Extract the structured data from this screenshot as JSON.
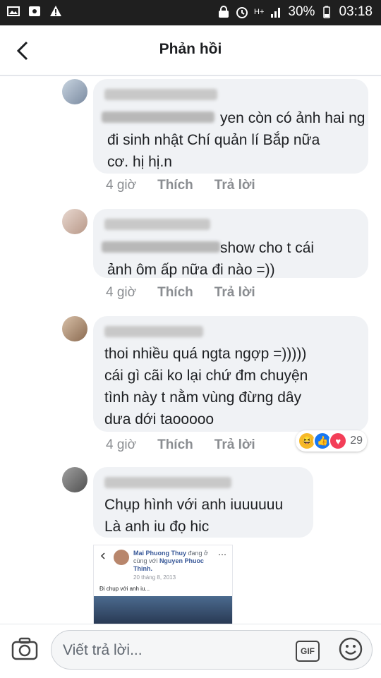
{
  "statusbar": {
    "battery": "30%",
    "time": "03:18",
    "network": "H+"
  },
  "header": {
    "title": "Phản hồi",
    "back_icon": "arrow-back-icon"
  },
  "comments": [
    {
      "text": "yen còn có ảnh hai ng\nđi sinh nhật Chí quản lí Bắp nữa\ncơ. hị hị.n",
      "time": "4 giờ",
      "like": "Thích",
      "reply": "Trả lời"
    },
    {
      "text": "show cho t cái\nảnh ôm ấp nữa đi nào =))",
      "time": "4 giờ",
      "like": "Thích",
      "reply": "Trả lời"
    },
    {
      "text": "thoi nhiều quá ngta ngợp =)))))\ncái gì cãi ko lại chứ đm chuyện\ntình này t nằm vùng đừng dây\ndưa dới taooooo",
      "time": "4 giờ",
      "like": "Thích",
      "reply": "Trả lời",
      "reaction_count": "29"
    },
    {
      "text": "Chụp hình với anh iuuuuuu\nLà anh iu đọ hic"
    }
  ],
  "embed": {
    "name": "Mai Phuong Thuy",
    "status": "đang ở cùng với",
    "tagged": "Nguyen Phuoc Thinh.",
    "date": "20 tháng 8, 2013",
    "caption": "Đi chụp với anh iu..."
  },
  "composer": {
    "placeholder": "Viết trả lời...",
    "gif_label": "GIF"
  },
  "colors": {
    "bubble": "#f0f2f5",
    "statusbar": "#1f1f1f",
    "meta": "#8a8d91"
  }
}
